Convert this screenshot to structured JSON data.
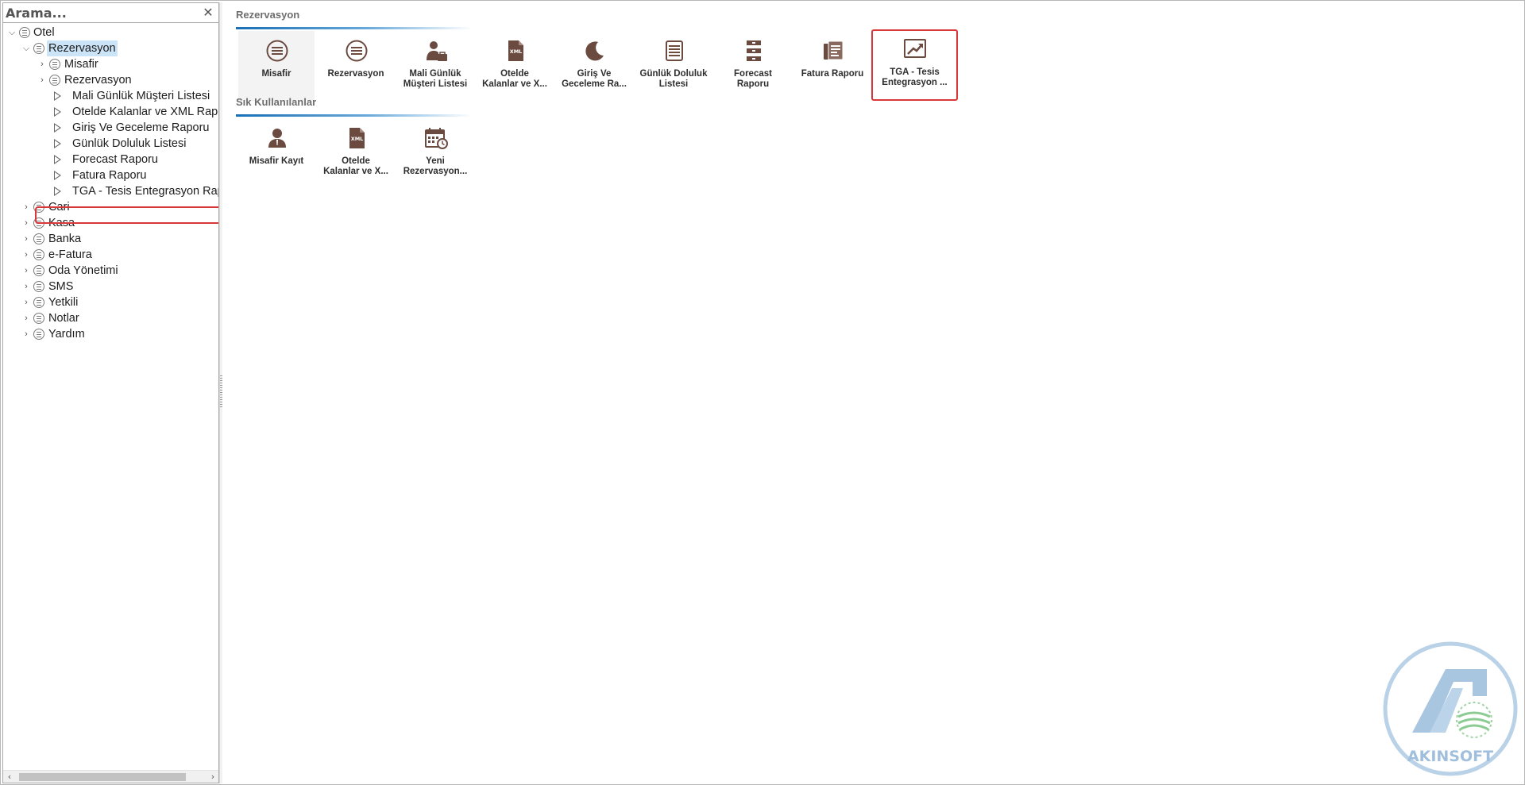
{
  "search": {
    "placeholder": "Arama...",
    "clear_icon": "close-icon"
  },
  "tree": {
    "root": {
      "label": "Otel"
    },
    "rezervasyon": {
      "label": "Rezervasyon"
    },
    "rez_children": [
      {
        "label": "Misafir"
      },
      {
        "label": "Rezervasyon"
      },
      {
        "label": "Mali Günlük Müşteri Listesi"
      },
      {
        "label": "Otelde Kalanlar ve XML Raporu"
      },
      {
        "label": "Giriş Ve Geceleme Raporu"
      },
      {
        "label": "Günlük Doluluk Listesi"
      },
      {
        "label": "Forecast Raporu"
      },
      {
        "label": "Fatura Raporu"
      },
      {
        "label": "TGA - Tesis Entegrasyon Raporu"
      }
    ],
    "modules": [
      {
        "label": "Cari"
      },
      {
        "label": "Kasa"
      },
      {
        "label": "Banka"
      },
      {
        "label": "e-Fatura"
      },
      {
        "label": "Oda Yönetimi"
      },
      {
        "label": "SMS"
      },
      {
        "label": "Yetkili"
      },
      {
        "label": "Notlar"
      },
      {
        "label": "Yardım"
      }
    ]
  },
  "sections": {
    "main": {
      "title": "Rezervasyon",
      "tiles": [
        {
          "l1": "Misafir",
          "l2": "",
          "icon": "list-circle-icon"
        },
        {
          "l1": "Rezervasyon",
          "l2": "",
          "icon": "list-circle-icon"
        },
        {
          "l1": "Mali Günlük",
          "l2": "Müşteri Listesi",
          "icon": "person-briefcase-icon"
        },
        {
          "l1": "Otelde",
          "l2": "Kalanlar ve X...",
          "icon": "xml-file-icon"
        },
        {
          "l1": "Giriş Ve",
          "l2": "Geceleme Ra...",
          "icon": "moon-icon"
        },
        {
          "l1": "Günlük Doluluk",
          "l2": "Listesi",
          "icon": "list-lines-icon"
        },
        {
          "l1": "Forecast",
          "l2": "Raporu",
          "icon": "forecast-icon"
        },
        {
          "l1": "Fatura Raporu",
          "l2": "",
          "icon": "invoice-icon"
        },
        {
          "l1": "TGA - Tesis",
          "l2": "Entegrasyon ...",
          "icon": "trend-chart-icon"
        }
      ]
    },
    "frequent": {
      "title": "Sık Kullanılanlar",
      "tiles": [
        {
          "l1": "Misafir Kayıt",
          "l2": "",
          "icon": "person-icon"
        },
        {
          "l1": "Otelde",
          "l2": "Kalanlar ve X...",
          "icon": "xml-file-icon"
        },
        {
          "l1": "Yeni",
          "l2": "Rezervasyon...",
          "icon": "calendar-clock-icon"
        }
      ]
    }
  },
  "logo": {
    "text": "AKINSOFT",
    "color": "#8fb6d8",
    "accent": "#4caf50"
  },
  "colors": {
    "icon_brown": "#6b4b40",
    "highlight_red": "#d9383a",
    "selection_blue": "#cce4f7",
    "section_line": "#1a6fb5"
  }
}
